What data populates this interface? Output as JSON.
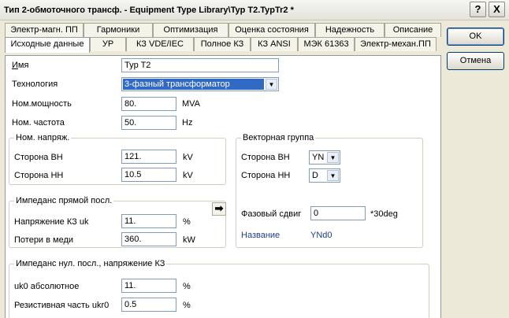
{
  "window": {
    "title": "Тип 2-обмоточного трансф. - Equipment Type Library\\Typ T2.TypTr2 *",
    "help_label": "?",
    "close_label": "X"
  },
  "tabs_row1": [
    {
      "label": "Электр-магн. ПП"
    },
    {
      "label": "Гармоники"
    },
    {
      "label": "Оптимизация"
    },
    {
      "label": "Оценка состояния"
    },
    {
      "label": "Надежность"
    },
    {
      "label": "Описание"
    }
  ],
  "tabs_row2": [
    {
      "label": "Исходные данные",
      "active": true
    },
    {
      "label": "УР"
    },
    {
      "label": "КЗ VDE/IEC"
    },
    {
      "label": "Полное КЗ"
    },
    {
      "label": "КЗ ANSI"
    },
    {
      "label": "МЭК 61363"
    },
    {
      "label": "Электр-механ.ПП"
    }
  ],
  "form": {
    "name_label": "Имя",
    "name_value": "Typ T2",
    "tech_label": "Технология",
    "tech_value": "3-фазный трансформатор",
    "power_label": "Ном.мощность",
    "power_value": "80.",
    "power_unit": "MVA",
    "freq_label": "Ном. частота",
    "freq_value": "50.",
    "freq_unit": "Hz"
  },
  "rated_voltage": {
    "title": "Ном. напряж.",
    "hv_label": "Сторона ВН",
    "hv_value": "121.",
    "hv_unit": "kV",
    "lv_label": "Сторона НН",
    "lv_value": "10.5",
    "lv_unit": "kV"
  },
  "pos_seq": {
    "title": "Импеданс прямой посл.",
    "uk_label": "Напряжение КЗ uk",
    "uk_value": "11.",
    "uk_unit": "%",
    "pcu_label": "Потери в меди",
    "pcu_value": "360.",
    "pcu_unit": "kW",
    "arrow_icon": "➡"
  },
  "vector_group": {
    "title": "Векторная группа",
    "hv_label": "Сторона ВН",
    "hv_value": "YN",
    "lv_label": "Сторона НН",
    "lv_value": "D",
    "shift_label": "Фазовый сдвиг",
    "shift_value": "0",
    "shift_unit": "*30deg",
    "name_label": "Название",
    "name_value": "YNd0"
  },
  "zero_seq": {
    "title": "Импеданс нул. посл., напряжение КЗ",
    "uk0_label": "uk0 абсолютное",
    "uk0_value": "11.",
    "uk0_unit": "%",
    "ukr0_label": "Резистивная часть ukr0",
    "ukr0_value": "0.5",
    "ukr0_unit": "%"
  },
  "buttons": {
    "ok": "OK",
    "cancel": "Отмена"
  },
  "colors": {
    "dialog_bg": "#ece9d8",
    "selection": "#316ac5",
    "label_blue": "#1f3c88"
  }
}
